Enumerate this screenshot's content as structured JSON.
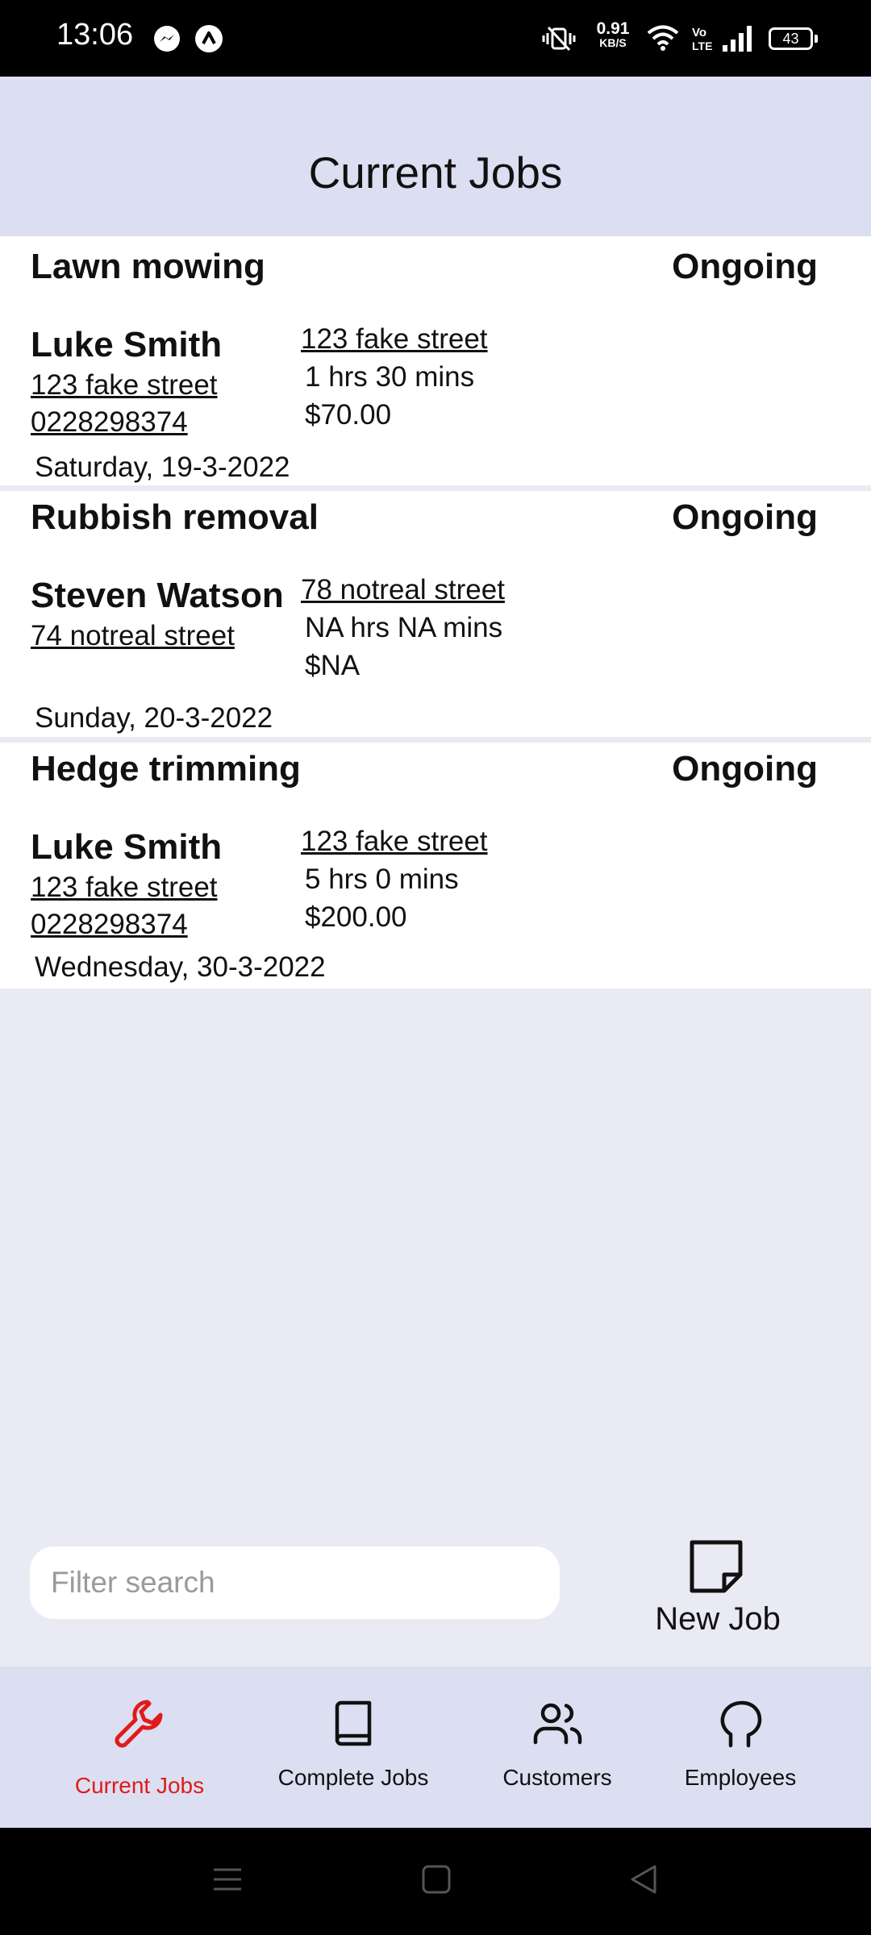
{
  "status_bar": {
    "time": "13:06",
    "speed_value": "0.91",
    "speed_unit": "KB/S",
    "battery": "43",
    "icons": [
      "messenger-icon",
      "app-notification-icon",
      "vibrate-icon",
      "wifi-icon",
      "volte-icon",
      "signal-icon",
      "battery-icon"
    ]
  },
  "header": {
    "title": "Current Jobs"
  },
  "jobs": [
    {
      "title": "Lawn mowing",
      "status": "Ongoing",
      "customer_name": "Luke Smith",
      "customer_address": "123 fake street",
      "customer_phone": "0228298374",
      "job_address": "123 fake street",
      "duration": "1 hrs 30 mins",
      "price": "$70.00",
      "date": "Saturday, 19-3-2022"
    },
    {
      "title": "Rubbish removal",
      "status": "Ongoing",
      "customer_name": "Steven Watson",
      "customer_address": "74 notreal street",
      "customer_phone": "",
      "job_address": "78 notreal street",
      "duration": "NA hrs NA mins",
      "price": "$NA",
      "date": "Sunday, 20-3-2022"
    },
    {
      "title": "Hedge trimming",
      "status": "Ongoing",
      "customer_name": "Luke Smith",
      "customer_address": "123 fake street",
      "customer_phone": "0228298374",
      "job_address": "123 fake street",
      "duration": "5 hrs 0 mins",
      "price": "$200.00",
      "date": "Wednesday, 30-3-2022"
    }
  ],
  "search": {
    "placeholder": "Filter search",
    "value": ""
  },
  "new_job": {
    "label": "New Job",
    "icon": "sticky-note-icon"
  },
  "bottom_nav": {
    "items": [
      {
        "label": "Current Jobs",
        "icon": "wrench-icon",
        "active": true
      },
      {
        "label": "Complete Jobs",
        "icon": "book-icon",
        "active": false
      },
      {
        "label": "Customers",
        "icon": "users-icon",
        "active": false
      },
      {
        "label": "Employees",
        "icon": "head-icon",
        "active": false
      }
    ]
  },
  "system_nav": {
    "icons": [
      "menu-icon",
      "home-icon",
      "back-icon"
    ]
  },
  "colors": {
    "accent_active": "#e01b1b",
    "header_bg": "#dcdff1",
    "page_bg": "#e9eaf4",
    "card_bg": "#ffffff"
  }
}
